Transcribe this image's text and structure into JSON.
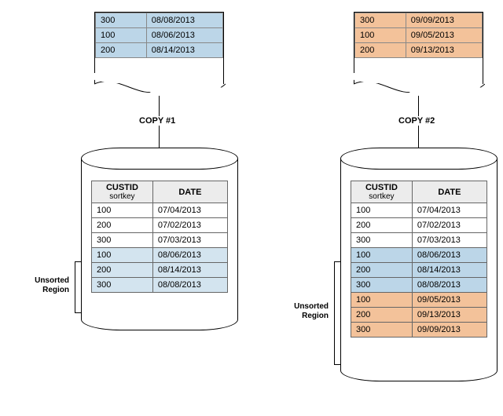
{
  "copy_labels": {
    "c1": "COPY #1",
    "c2": "COPY #2"
  },
  "headers": {
    "custid": "CUSTID",
    "sortkey": "sortkey",
    "date": "DATE"
  },
  "unsorted_label_line1": "Unsorted",
  "unsorted_label_line2": "Region",
  "page1": {
    "rows": [
      {
        "id": "300",
        "date": "08/08/2013"
      },
      {
        "id": "100",
        "date": "08/06/2013"
      },
      {
        "id": "200",
        "date": "08/14/2013"
      }
    ]
  },
  "page2": {
    "rows": [
      {
        "id": "300",
        "date": "09/09/2013"
      },
      {
        "id": "100",
        "date": "09/05/2013"
      },
      {
        "id": "200",
        "date": "09/13/2013"
      }
    ]
  },
  "cyl1": {
    "rows": [
      {
        "id": "100",
        "date": "07/04/2013",
        "cls": ""
      },
      {
        "id": "200",
        "date": "07/02/2013",
        "cls": ""
      },
      {
        "id": "300",
        "date": "07/03/2013",
        "cls": ""
      },
      {
        "id": "100",
        "date": "08/06/2013",
        "cls": "row-blue"
      },
      {
        "id": "200",
        "date": "08/14/2013",
        "cls": "row-blue"
      },
      {
        "id": "300",
        "date": "08/08/2013",
        "cls": "row-blue"
      }
    ]
  },
  "cyl2": {
    "rows": [
      {
        "id": "100",
        "date": "07/04/2013",
        "cls": ""
      },
      {
        "id": "200",
        "date": "07/02/2013",
        "cls": ""
      },
      {
        "id": "300",
        "date": "07/03/2013",
        "cls": ""
      },
      {
        "id": "100",
        "date": "08/06/2013",
        "cls": "row-blue-strong"
      },
      {
        "id": "200",
        "date": "08/14/2013",
        "cls": "row-blue-strong"
      },
      {
        "id": "300",
        "date": "08/08/2013",
        "cls": "row-blue-strong"
      },
      {
        "id": "100",
        "date": "09/05/2013",
        "cls": "row-orange"
      },
      {
        "id": "200",
        "date": "09/13/2013",
        "cls": "row-orange"
      },
      {
        "id": "300",
        "date": "09/09/2013",
        "cls": "row-orange"
      }
    ]
  }
}
